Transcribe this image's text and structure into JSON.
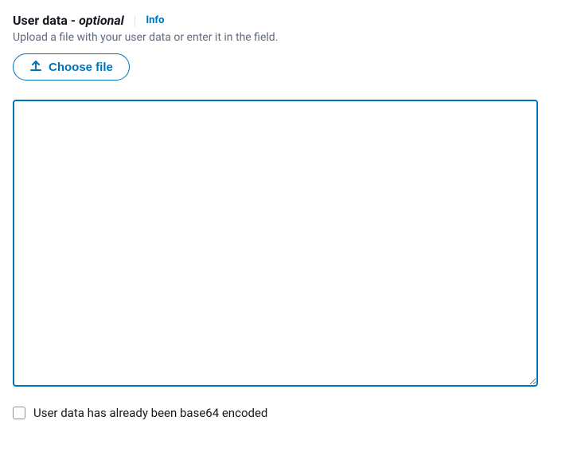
{
  "header": {
    "title": "User data",
    "dash": " - ",
    "optional": "optional",
    "separator": "|",
    "info_label": "Info"
  },
  "description": "Upload a file with your user data or enter it in the field.",
  "choose_file_label": "Choose file",
  "user_data_value": "",
  "checkbox": {
    "checked": false,
    "label": "User data has already been base64 encoded"
  },
  "colors": {
    "primary": "#0073bb",
    "text": "#16191f",
    "muted": "#5f6b7a"
  }
}
